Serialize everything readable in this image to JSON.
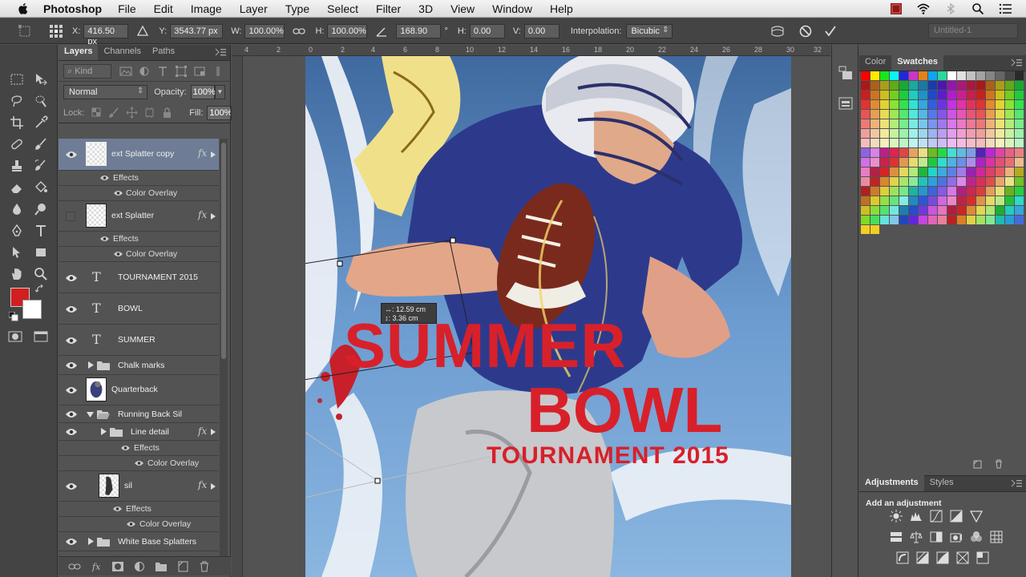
{
  "menubar": {
    "app_name": "Photoshop",
    "items": [
      "File",
      "Edit",
      "Image",
      "Layer",
      "Type",
      "Select",
      "Filter",
      "3D",
      "View",
      "Window",
      "Help"
    ]
  },
  "options": {
    "x_label": "X:",
    "x_value": "416.50 px",
    "y_label": "Y:",
    "y_value": "3543.77 px",
    "w_label": "W:",
    "w_value": "100.00%",
    "h_label": "H:",
    "h_value": "100.00%",
    "angle_value": "168.90",
    "angle_unit": "°",
    "hskew_label": "H:",
    "hskew_value": "0.00",
    "vskew_label": "V:",
    "vskew_value": "0.00",
    "interpolation_label": "Interpolation:",
    "interpolation_value": "Bicubic",
    "workspace": "Untitled-1"
  },
  "layers_panel": {
    "tabs": [
      "Layers",
      "Channels",
      "Paths"
    ],
    "kind_label": "Kind",
    "blend_mode": "Normal",
    "opacity_label": "Opacity:",
    "opacity_value": "100%",
    "lock_label": "Lock:",
    "fill_label": "Fill:",
    "fill_value": "100%",
    "layers": [
      {
        "name": "ext Splatter copy",
        "kind": "pixel",
        "visible": true,
        "selected": true,
        "fx": true
      },
      {
        "name": "Effects",
        "kind": "effects"
      },
      {
        "name": "Color Overlay",
        "kind": "effect"
      },
      {
        "name": "ext Splatter",
        "kind": "pixel",
        "visible": false,
        "fx": true
      },
      {
        "name": "Effects",
        "kind": "effects"
      },
      {
        "name": "Color Overlay",
        "kind": "effect"
      },
      {
        "name": "TOURNAMENT 2015",
        "kind": "type",
        "visible": true
      },
      {
        "name": "BOWL",
        "kind": "type",
        "visible": true
      },
      {
        "name": "SUMMER",
        "kind": "type",
        "visible": true
      },
      {
        "name": "Chalk marks",
        "kind": "group",
        "visible": true
      },
      {
        "name": "Quarterback",
        "kind": "pixel",
        "visible": true
      },
      {
        "name": "Running Back Sil",
        "kind": "group-open",
        "visible": true
      },
      {
        "name": "Line detail",
        "kind": "group",
        "visible": true,
        "fx": true
      },
      {
        "name": "Effects",
        "kind": "effects"
      },
      {
        "name": "Color Overlay",
        "kind": "effect"
      },
      {
        "name": "sil",
        "kind": "pixel",
        "visible": true,
        "fx": true
      },
      {
        "name": "Effects",
        "kind": "effects"
      },
      {
        "name": "Color Overlay",
        "kind": "effect"
      },
      {
        "name": "White Base Splatters",
        "kind": "group",
        "visible": true
      }
    ],
    "fx_label": "fx"
  },
  "canvas": {
    "ruler_labels": [
      "4",
      "2",
      "0",
      "2",
      "4",
      "6",
      "8",
      "10",
      "12",
      "14",
      "16",
      "18",
      "20",
      "22",
      "24",
      "26",
      "28",
      "30",
      "32"
    ],
    "poster_line1": "SUMMER",
    "poster_line2": "BOWL",
    "poster_line3": "TOURNAMENT 2015",
    "tip_width": "↔: 12.59 cm",
    "tip_height": "↕: 3.36 cm",
    "poster_title_color": "#d8202a"
  },
  "right_panels": {
    "swatch_tabs": [
      "Color",
      "Swatches"
    ],
    "adjust_tabs": [
      "Adjustments",
      "Styles"
    ],
    "adjust_title": "Add an adjustment"
  },
  "colors": {
    "foreground": "#d11f1f",
    "background": "#ffffff",
    "selection": "#6e7d95"
  }
}
